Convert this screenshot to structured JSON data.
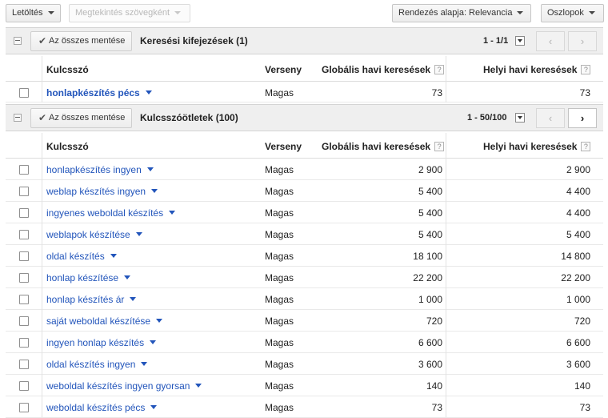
{
  "toolbar": {
    "download_label": "Letöltés",
    "view_as_text_label": "Megtekintés szövegként",
    "sort_label": "Rendezés alapja: Relevancia",
    "columns_label": "Oszlopok"
  },
  "search_terms": {
    "save_all_label": "Az összes mentése",
    "title": "Keresési kifejezések (1)",
    "pager": "1 - 1/1",
    "headers": {
      "keyword": "Kulcsszó",
      "competition": "Verseny",
      "global": "Globális havi keresések",
      "local": "Helyi havi keresések",
      "help": "?"
    },
    "rows": [
      {
        "keyword": "honlapkészítés pécs",
        "competition": "Magas",
        "global": "73",
        "local": "73"
      }
    ]
  },
  "ideas": {
    "save_all_label": "Az összes mentése",
    "title": "Kulcsszóötletek (100)",
    "pager": "1 - 50/100",
    "headers": {
      "keyword": "Kulcsszó",
      "competition": "Verseny",
      "global": "Globális havi keresések",
      "local": "Helyi havi keresések",
      "help": "?"
    },
    "rows": [
      {
        "keyword": "honlapkészítés ingyen",
        "competition": "Magas",
        "global": "2 900",
        "local": "2 900"
      },
      {
        "keyword": "weblap készítés ingyen",
        "competition": "Magas",
        "global": "5 400",
        "local": "4 400"
      },
      {
        "keyword": "ingyenes weboldal készítés",
        "competition": "Magas",
        "global": "5 400",
        "local": "4 400"
      },
      {
        "keyword": "weblapok készítése",
        "competition": "Magas",
        "global": "5 400",
        "local": "5 400"
      },
      {
        "keyword": "oldal készítés",
        "competition": "Magas",
        "global": "18 100",
        "local": "14 800"
      },
      {
        "keyword": "honlap készítése",
        "competition": "Magas",
        "global": "22 200",
        "local": "22 200"
      },
      {
        "keyword": "honlap készítés ár",
        "competition": "Magas",
        "global": "1 000",
        "local": "1 000"
      },
      {
        "keyword": "saját weboldal készítése",
        "competition": "Magas",
        "global": "720",
        "local": "720"
      },
      {
        "keyword": "ingyen honlap készítés",
        "competition": "Magas",
        "global": "6 600",
        "local": "6 600"
      },
      {
        "keyword": "oldal készítés ingyen",
        "competition": "Magas",
        "global": "3 600",
        "local": "3 600"
      },
      {
        "keyword": "weboldal készítés ingyen gyorsan",
        "competition": "Magas",
        "global": "140",
        "local": "140"
      },
      {
        "keyword": "weboldal készítés pécs",
        "competition": "Magas",
        "global": "73",
        "local": "73"
      }
    ]
  }
}
